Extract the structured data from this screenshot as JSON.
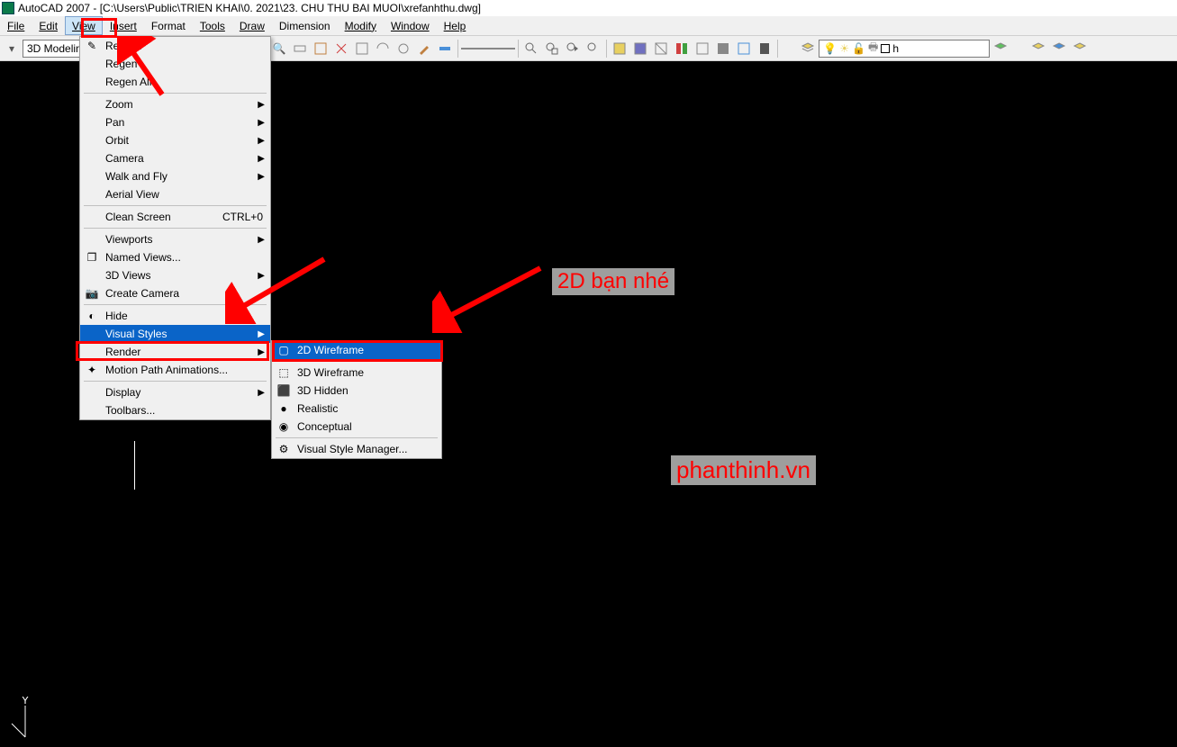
{
  "title": "AutoCAD 2007 - [C:\\Users\\Public\\TRIEN KHAI\\0. 2021\\23. CHU THU BAI MUOI\\xrefanhthu.dwg]",
  "menubar": {
    "file": "File",
    "edit": "Edit",
    "view": "View",
    "insert": "Insert",
    "format": "Format",
    "tools": "Tools",
    "draw": "Draw",
    "dimension": "Dimension",
    "modify": "Modify",
    "window": "Window",
    "help": "Help"
  },
  "workspace": {
    "label": "3D Modeling"
  },
  "layer": {
    "name": "h"
  },
  "view_menu": {
    "redraw": "Redraw",
    "regen": "Regen",
    "regen_all": "Regen All",
    "zoom": "Zoom",
    "pan": "Pan",
    "orbit": "Orbit",
    "camera": "Camera",
    "walk_fly": "Walk and Fly",
    "aerial": "Aerial View",
    "clean": "Clean Screen",
    "clean_sc": "CTRL+0",
    "viewports": "Viewports",
    "named_views": "Named Views...",
    "views_3d": "3D Views",
    "create_camera": "Create Camera",
    "hide": "Hide",
    "visual_styles": "Visual Styles",
    "render": "Render",
    "motion": "Motion Path Animations...",
    "display": "Display",
    "toolbars": "Toolbars..."
  },
  "submenu": {
    "wf2d": "2D Wireframe",
    "wf3d": "3D Wireframe",
    "hidden3d": "3D Hidden",
    "realistic": "Realistic",
    "conceptual": "Conceptual",
    "manager": "Visual Style Manager..."
  },
  "annotations": {
    "note1": "2D bạn nhé",
    "note2": "phanthinh.vn"
  }
}
